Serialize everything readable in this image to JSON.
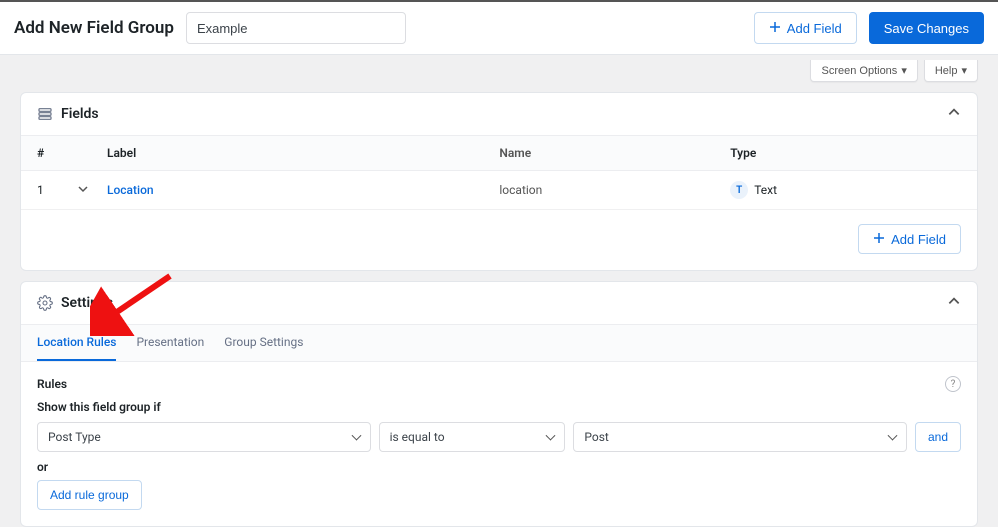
{
  "header": {
    "title": "Add New Field Group",
    "title_value": "Example",
    "add_field": "Add Field",
    "save_changes": "Save Changes"
  },
  "screen": {
    "options": "Screen Options",
    "help": "Help"
  },
  "fields_panel": {
    "title": "Fields",
    "columns": {
      "num": "#",
      "label": "Label",
      "name": "Name",
      "type": "Type"
    },
    "rows": [
      {
        "num": "1",
        "label": "Location",
        "name": "location",
        "type_code": "T",
        "type_label": "Text"
      }
    ],
    "add_field": "Add Field"
  },
  "settings_panel": {
    "title": "Settings",
    "tabs": [
      {
        "label": "Location Rules",
        "active": true
      },
      {
        "label": "Presentation",
        "active": false
      },
      {
        "label": "Group Settings",
        "active": false
      }
    ],
    "rules_title": "Rules",
    "rules_hint": "Show this field group if",
    "rule": {
      "param": "Post Type",
      "op": "is equal to",
      "value": "Post"
    },
    "and": "and",
    "or": "or",
    "add_group": "Add rule group"
  }
}
